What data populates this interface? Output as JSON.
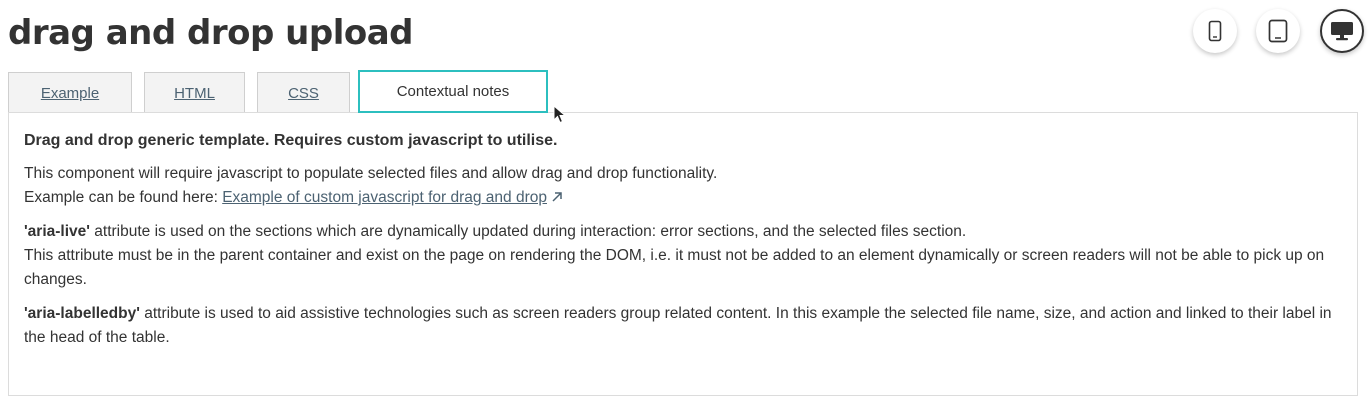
{
  "page": {
    "title": "drag and drop upload"
  },
  "device_toggle": [
    {
      "name": "mobile",
      "icon": "mobile-phone-icon"
    },
    {
      "name": "tablet",
      "icon": "tablet-icon"
    },
    {
      "name": "desktop",
      "icon": "desktop-monitor-icon",
      "selected": true
    }
  ],
  "tabs": [
    {
      "label": "Example"
    },
    {
      "label": "HTML"
    },
    {
      "label": "CSS"
    },
    {
      "label": "Contextual notes",
      "active": true
    }
  ],
  "notes": {
    "heading": "Drag and drop generic template. Requires custom javascript to utilise.",
    "intro_line1": "This component will require javascript to populate selected files and allow drag and drop functionality.",
    "intro_line2_prefix": "Example can be found here: ",
    "intro_link": "Example of custom javascript for drag and drop",
    "aria_live_term": "'aria-live'",
    "aria_live_text": " attribute is used on the sections which are dynamically updated during interaction: error sections, and the selected files section.",
    "aria_live_line2": "This attribute must be in the parent container and exist on the page on rendering the DOM, i.e. it must not be added to an element dynamically or screen readers will not be able to pick up on changes.",
    "aria_labelledby_term": "'aria-labelledby'",
    "aria_labelledby_text": " attribute is used to aid assistive technologies such as screen readers group related content. In this example the selected file name, size, and action and linked to their label in the head of the table."
  },
  "colors": {
    "text": "#333333",
    "link": "#4c6272",
    "active_tab_border": "#2cbfbf",
    "tab_bg": "#f3f3f3",
    "panel_border": "#dcdcdc"
  }
}
